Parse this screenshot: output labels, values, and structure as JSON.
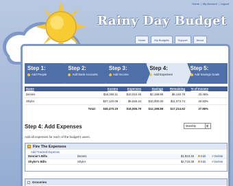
{
  "app": {
    "title": "Rainy Day Budget"
  },
  "toplinks": [
    "Home",
    "My Account",
    "Logout"
  ],
  "tabs": [
    "Home",
    "My Budgets",
    "Support",
    "About"
  ],
  "steps": [
    {
      "title": "Step 1:",
      "label": "Add People"
    },
    {
      "title": "Step 2:",
      "label": "Add Bank Accounts"
    },
    {
      "title": "Step 3:",
      "label": "Add Income"
    },
    {
      "title": "Step 4:",
      "label": "Add Expenses"
    },
    {
      "title": "Step 5:",
      "label": "Add Savings Goals"
    }
  ],
  "summary": {
    "headers": [
      "Name",
      "Income",
      "Expenses",
      "Savings",
      "Remaining",
      "% of Income"
    ],
    "rows": [
      [
        "Dennis",
        "$18,350.11",
        "$10,010.45",
        "$2,198.88",
        "$6,140.78",
        "33.46%"
      ],
      [
        "Shyler",
        "$27,120.08",
        "$6,046.34",
        "$10,000.00",
        "$11,073.74",
        "40.83%"
      ],
      [
        "Total:",
        "$45,470.19",
        "$16,056.79",
        "$12,198.88",
        "$17,214.52",
        "37.86%"
      ]
    ]
  },
  "step_heading": "Step 4: Add Expenses",
  "period_select": {
    "value": "Monthly"
  },
  "description": "Add all expenses for each of the budget's users.",
  "expenses_panel": {
    "title": "Fire The Expenses",
    "add_link": "Add Tracked Expense",
    "rows": [
      {
        "name": "Dennis's Bills",
        "owner": "Dennis",
        "amount": "$1,923.45",
        "edit": "Edit",
        "delete": "Delete"
      },
      {
        "name": "Shyler's Bills",
        "owner": "Shyler",
        "amount": "$2,718.38",
        "edit": "Edit",
        "delete": "Delete"
      }
    ]
  },
  "panel2": {
    "title": "Groceries"
  }
}
